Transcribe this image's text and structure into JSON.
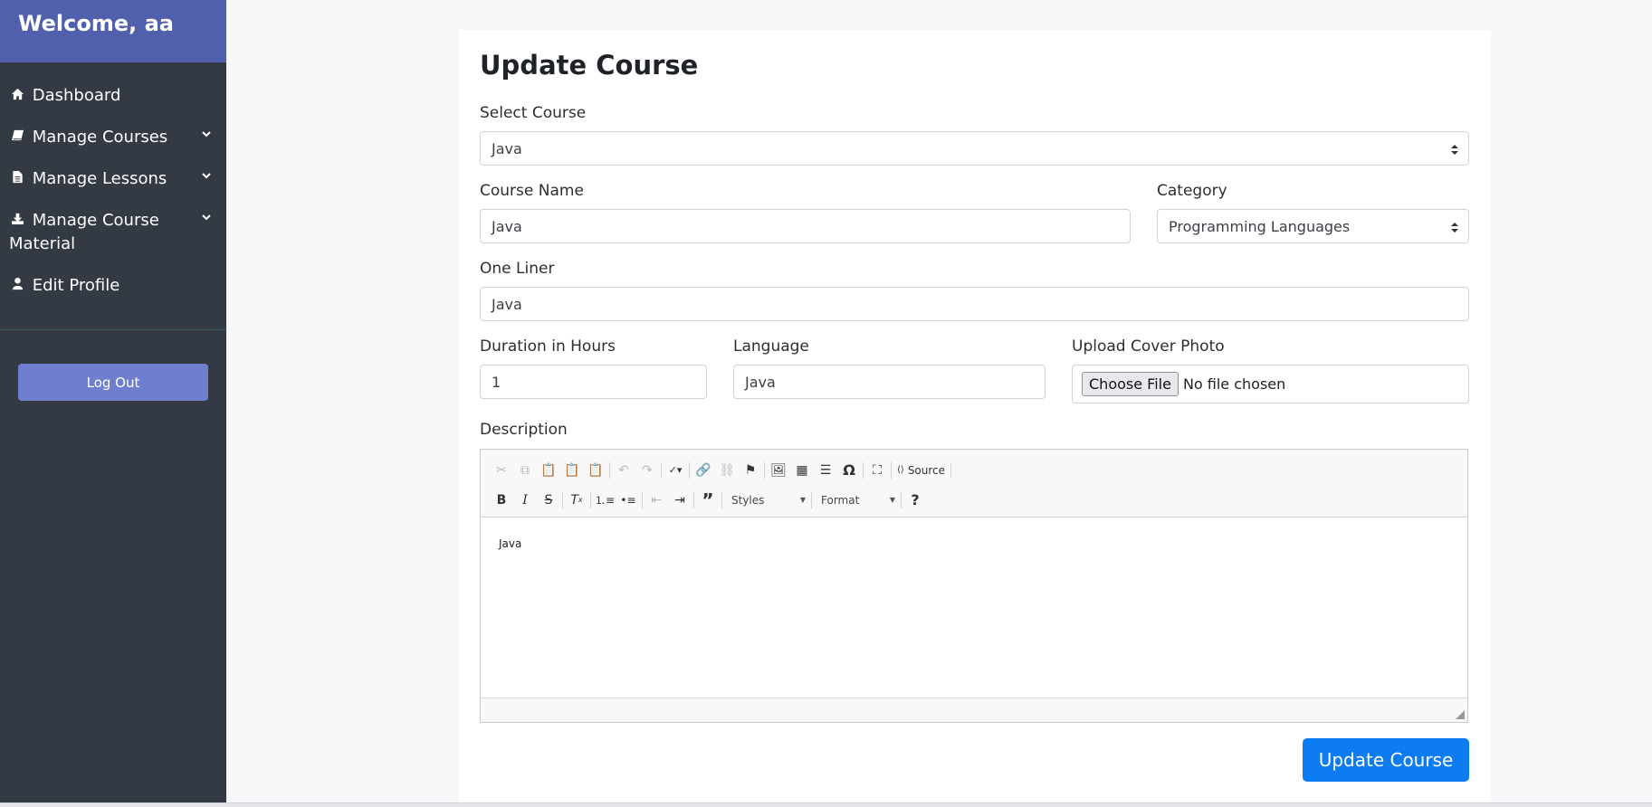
{
  "sidebar": {
    "welcome": "Welcome, aa",
    "items": [
      {
        "label": "Dashboard",
        "icon": "home-icon"
      },
      {
        "label": "Manage Courses",
        "icon": "book-icon",
        "expandable": true
      },
      {
        "label": "Manage Lessons",
        "icon": "file-icon",
        "expandable": true
      },
      {
        "label": "Manage Course Material",
        "icon": "download-icon",
        "expandable": true
      },
      {
        "label": "Edit Profile",
        "icon": "user-icon"
      }
    ],
    "logout_label": "Log Out"
  },
  "form": {
    "title": "Update Course",
    "select_course": {
      "label": "Select Course",
      "value": "Java"
    },
    "course_name": {
      "label": "Course Name",
      "value": "Java"
    },
    "category": {
      "label": "Category",
      "value": "Programming Languages"
    },
    "one_liner": {
      "label": "One Liner",
      "value": "Java"
    },
    "duration": {
      "label": "Duration in Hours",
      "value": "1"
    },
    "language": {
      "label": "Language",
      "value": "Java"
    },
    "cover_photo": {
      "label": "Upload Cover Photo",
      "button": "Choose File",
      "status": "No file chosen"
    },
    "description": {
      "label": "Description",
      "content": "Java",
      "toolbar": {
        "source_label": "Source",
        "styles_label": "Styles",
        "format_label": "Format"
      }
    },
    "submit_label": "Update Course"
  },
  "colors": {
    "sidebar_bg": "#333a44",
    "header_bg": "#5160ad",
    "logout_bg": "#6f7fd0",
    "primary": "#0d7bf2"
  }
}
